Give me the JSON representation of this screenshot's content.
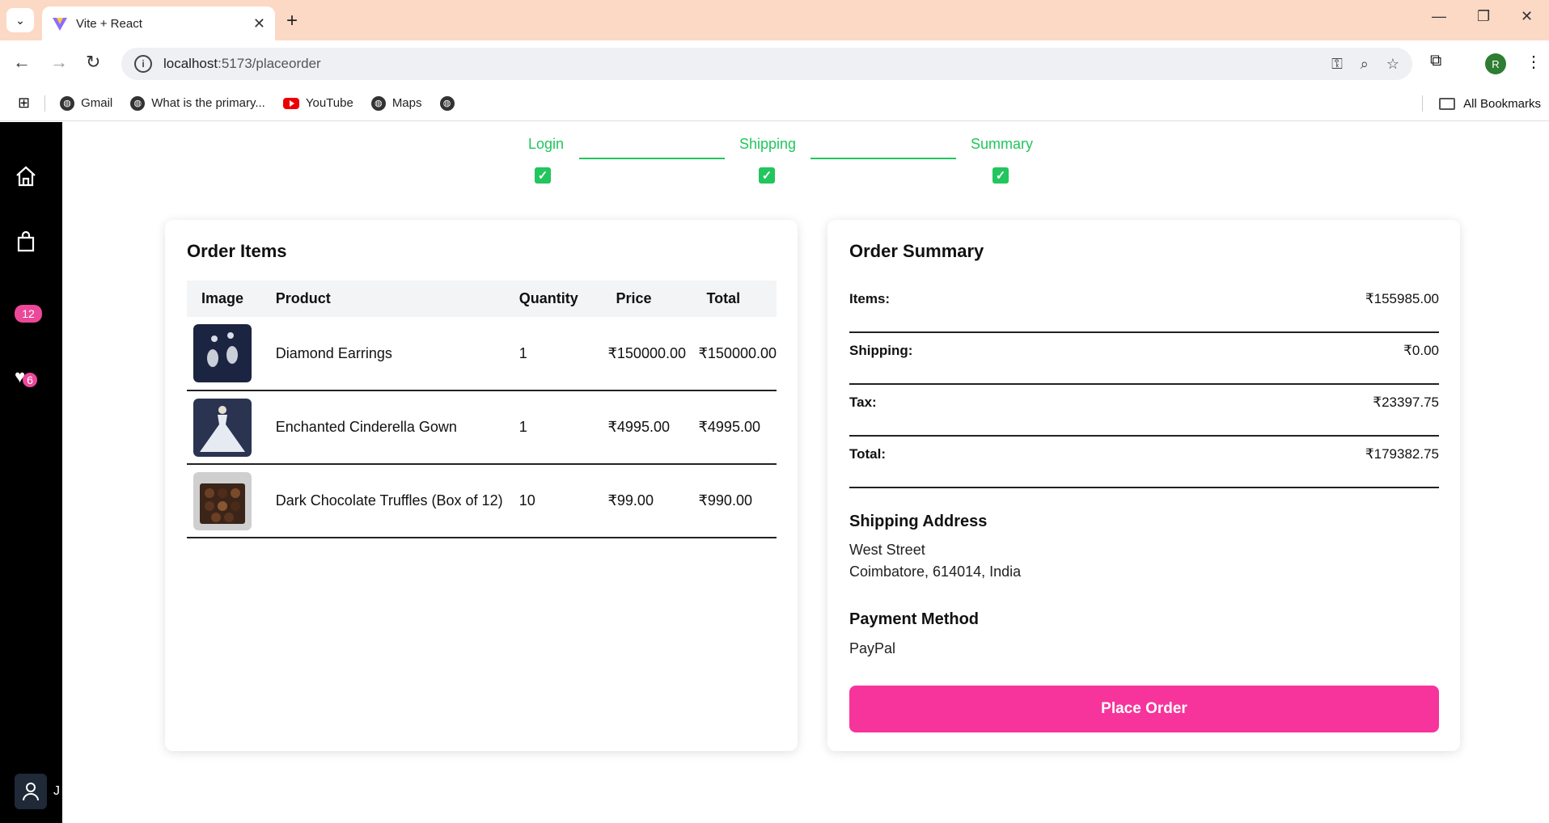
{
  "browser": {
    "tab_title": "Vite + React",
    "url_host": "localhost",
    "url_path": ":5173/placeorder",
    "profile_initial": "R",
    "bookmarks": [
      "Gmail",
      "What is the primary...",
      "YouTube",
      "Maps"
    ],
    "all_bookmarks": "All Bookmarks"
  },
  "sidebar": {
    "cart_count": "12",
    "favorites_count": "6",
    "user_text": "J"
  },
  "steps": {
    "login": "Login",
    "shipping": "Shipping",
    "summary": "Summary"
  },
  "order_items": {
    "title": "Order Items",
    "headers": {
      "image": "Image",
      "product": "Product",
      "quantity": "Quantity",
      "price": "Price",
      "total": "Total"
    },
    "rows": [
      {
        "product": "Diamond Earrings",
        "quantity": "1",
        "price": "₹150000.00",
        "total": "₹150000.00",
        "thumb": "earrings"
      },
      {
        "product": "Enchanted Cinderella Gown",
        "quantity": "1",
        "price": "₹4995.00",
        "total": "₹4995.00",
        "thumb": "gown"
      },
      {
        "product": "Dark Chocolate Truffles (Box of 12)",
        "quantity": "10",
        "price": "₹99.00",
        "total": "₹990.00",
        "thumb": "truffles"
      }
    ]
  },
  "order_summary": {
    "title": "Order Summary",
    "items_label": "Items:",
    "items_value": "₹155985.00",
    "shipping_label": "Shipping:",
    "shipping_value": "₹0.00",
    "tax_label": "Tax:",
    "tax_value": "₹23397.75",
    "total_label": "Total:",
    "total_value": "₹179382.75",
    "address_heading": "Shipping Address",
    "address_line1": "West Street",
    "address_line2": "Coimbatore, 614014, India",
    "payment_heading": "Payment Method",
    "payment_value": "PayPal",
    "place_order": "Place Order"
  },
  "colors": {
    "accent_green": "#22c55e",
    "button_pink": "#f7349b",
    "badge_pink": "#ec4899"
  }
}
